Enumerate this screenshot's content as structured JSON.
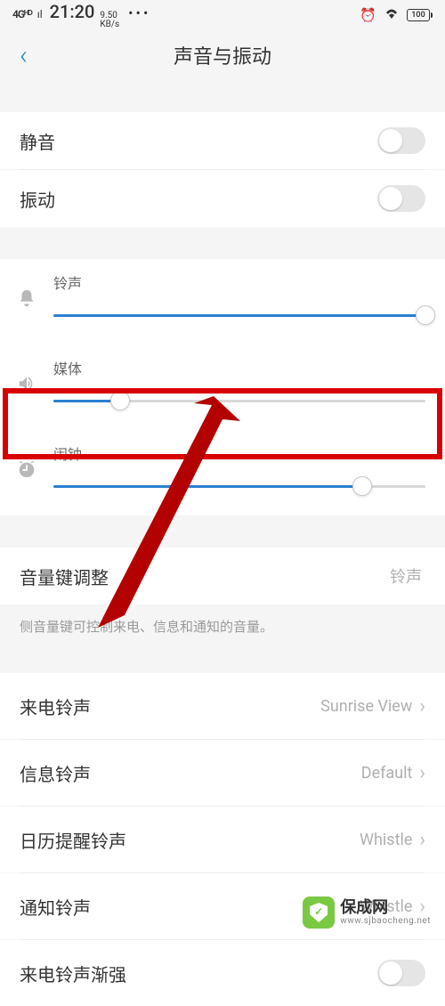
{
  "status": {
    "signal": "4Gᴴᴰ",
    "time": "21:20",
    "kbs_top": "9.50",
    "kbs_bot": "KB/s",
    "battery": "100"
  },
  "nav": {
    "back": "‹",
    "title": "声音与振动"
  },
  "toggles": {
    "mute": {
      "label": "静音",
      "on": false
    },
    "vibrate": {
      "label": "振动",
      "on": false
    }
  },
  "volumes": {
    "ring": {
      "label": "铃声",
      "pct": 100
    },
    "media": {
      "label": "媒体",
      "pct": 18
    },
    "alarm": {
      "label": "闹钟",
      "pct": 83
    }
  },
  "volkey": {
    "label": "音量键调整",
    "value": "铃声",
    "desc": "侧音量键可控制来电、信息和通知的音量。"
  },
  "rings": {
    "incoming": {
      "label": "来电铃声",
      "value": "Sunrise View"
    },
    "msg": {
      "label": "信息铃声",
      "value": "Default"
    },
    "calendar": {
      "label": "日历提醒铃声",
      "value": "Whistle"
    },
    "notif": {
      "label": "通知铃声",
      "value": "Whistle"
    },
    "crescendo": {
      "label": "来电铃声渐强"
    }
  },
  "watermark": {
    "name": "保成网",
    "url": "www.sjbaocheng.net"
  }
}
